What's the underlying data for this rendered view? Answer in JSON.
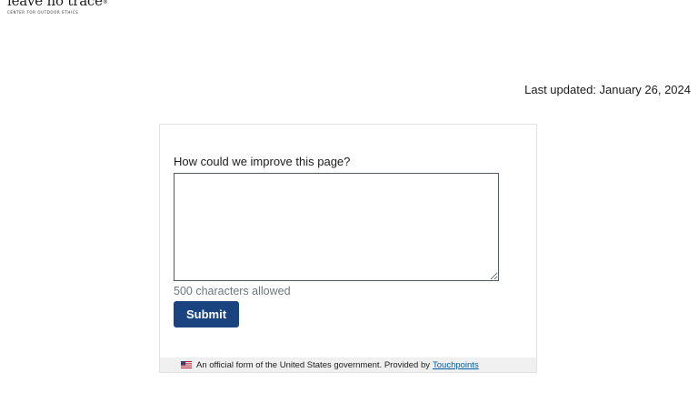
{
  "logo": {
    "name": "leave no trace",
    "trademark": "®",
    "tagline": "CENTER FOR OUTDOOR ETHICS"
  },
  "page": {
    "last_updated": "Last updated: January 26, 2024"
  },
  "feedback_form": {
    "question": "How could we improve this page?",
    "answer_value": "",
    "char_limit_text": "500 characters allowed",
    "submit_label": "Submit"
  },
  "gov_banner": {
    "text": "An official form of the United States government. Provided by",
    "link_text": "Touchpoints",
    "icon": "us-flag-icon"
  },
  "colors": {
    "submit_bg": "#1a4480",
    "link": "#005ea2",
    "banner_bg": "#f0f0f0",
    "muted_text": "#71767a"
  }
}
